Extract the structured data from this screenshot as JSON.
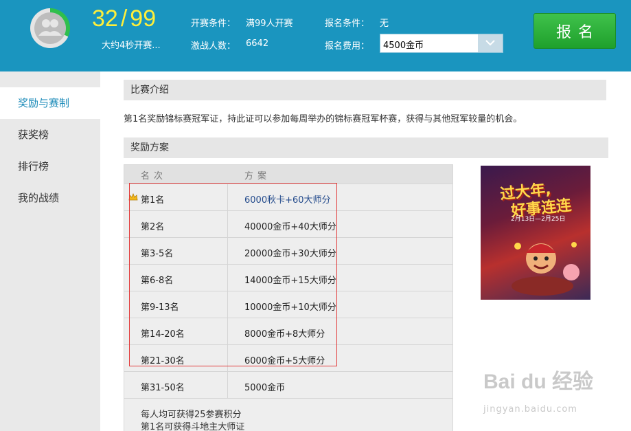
{
  "header": {
    "progress": {
      "current": "32",
      "separator": "/",
      "total": "99",
      "fraction": 0.32
    },
    "countdown": "大约4秒开赛...",
    "start_condition": {
      "label": "开赛条件：",
      "value": "满99人开赛"
    },
    "players": {
      "label": "激战人数：",
      "value": "6642"
    },
    "entry_condition": {
      "label": "报名条件：",
      "value": "无"
    },
    "entry_fee": {
      "label": "报名费用：",
      "selected": "4500金币"
    },
    "signup_button": "报名"
  },
  "sidebar": {
    "items": [
      {
        "label": "奖励与赛制",
        "active": true
      },
      {
        "label": "获奖榜",
        "active": false
      },
      {
        "label": "排行榜",
        "active": false
      },
      {
        "label": "我的战绩",
        "active": false
      }
    ]
  },
  "main": {
    "intro_title": "比赛介绍",
    "intro_text": "第1名奖励锦标赛冠军证，持此证可以参加每周举办的锦标赛冠军杯赛，获得与其他冠军较量的机会。",
    "reward_title": "奖励方案",
    "table": {
      "headers": [
        "名次",
        "方案"
      ],
      "rows": [
        {
          "rank": "第1名",
          "reward": "6000秋卡+60大师分"
        },
        {
          "rank": "第2名",
          "reward": "40000金币+40大师分"
        },
        {
          "rank": "第3-5名",
          "reward": "20000金币+30大师分"
        },
        {
          "rank": "第6-8名",
          "reward": "14000金币+15大师分"
        },
        {
          "rank": "第9-13名",
          "reward": "10000金币+10大师分"
        },
        {
          "rank": "第14-20名",
          "reward": "8000金币+8大师分"
        },
        {
          "rank": "第21-30名",
          "reward": "6000金币+5大师分"
        },
        {
          "rank": "第31-50名",
          "reward": "5000金币"
        }
      ],
      "notes": [
        "每人均可获得25参赛积分",
        "第1名可获得斗地主大师证"
      ]
    },
    "banner": {
      "line1": "过大年,",
      "line2": "好事连连",
      "dates": "2月13日—2月25日"
    }
  },
  "watermark": {
    "brand": "Bai du 经验",
    "url": "jingyan.baidu.com"
  },
  "colors": {
    "header_bg": "#1a95bf",
    "count": "#ffef3a",
    "button": "#28a835",
    "active_tab": "#1a8ab8",
    "highlight_box": "#e23a3a"
  }
}
